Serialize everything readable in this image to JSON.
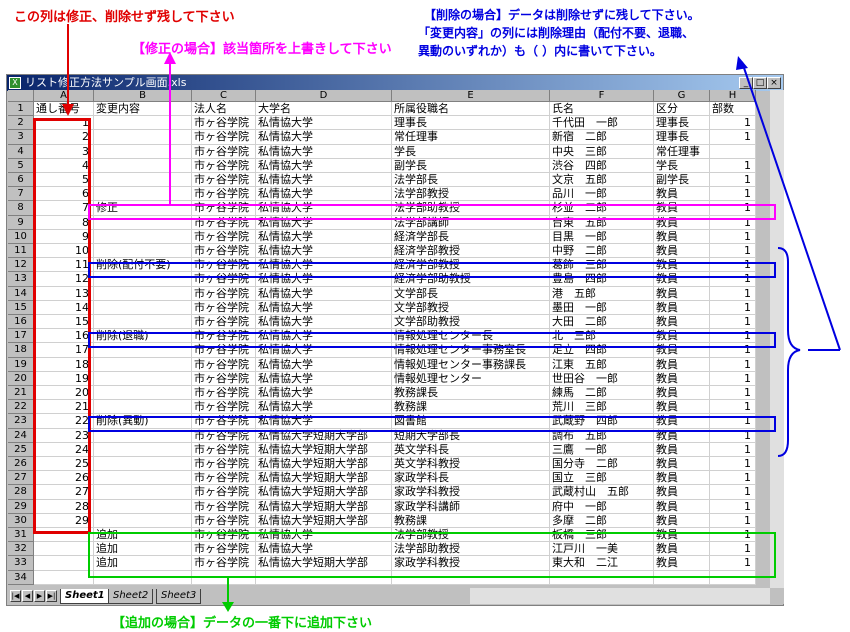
{
  "window": {
    "title": "リスト修正方法サンプル画面.xls",
    "buttons": [
      "_",
      "□",
      "×"
    ]
  },
  "columns": [
    "A",
    "B",
    "C",
    "D",
    "E",
    "F",
    "G",
    "H"
  ],
  "rows": [
    {
      "r": "1",
      "a": "通し番号",
      "b": "変更内容",
      "c": "法人名",
      "d": "大学名",
      "e": "所属役職名",
      "f": "氏名",
      "g": "区分",
      "h": "部数"
    },
    {
      "r": "2",
      "a": "1",
      "b": "",
      "c": "市ヶ谷学院",
      "d": "私情協大学",
      "e": "理事長",
      "f": "千代田　一郎",
      "g": "理事長",
      "h": "1"
    },
    {
      "r": "3",
      "a": "2",
      "b": "",
      "c": "市ヶ谷学院",
      "d": "私情協大学",
      "e": "常任理事",
      "f": "新宿　二郎",
      "g": "理事長",
      "h": "1"
    },
    {
      "r": "4",
      "a": "3",
      "b": "",
      "c": "市ヶ谷学院",
      "d": "私情協大学",
      "e": "学長",
      "f": "中央　三郎",
      "g": "常任理事",
      "h": ""
    },
    {
      "r": "5",
      "a": "4",
      "b": "",
      "c": "市ヶ谷学院",
      "d": "私情協大学",
      "e": "副学長",
      "f": "渋谷　四郎",
      "g": "学長",
      "h": "1"
    },
    {
      "r": "6",
      "a": "5",
      "b": "",
      "c": "市ヶ谷学院",
      "d": "私情協大学",
      "e": "法学部長",
      "f": "文京　五郎",
      "g": "副学長",
      "h": "1"
    },
    {
      "r": "7",
      "a": "6",
      "b": "",
      "c": "市ヶ谷学院",
      "d": "私情協大学",
      "e": "法学部教授",
      "f": "品川　一郎",
      "g": "教員",
      "h": "1"
    },
    {
      "r": "8",
      "a": "7",
      "b": "修正",
      "c": "市ヶ谷学院",
      "d": "私情協大学",
      "e": "法学部助教授",
      "f": "杉並　二郎",
      "g": "教員",
      "h": "1"
    },
    {
      "r": "9",
      "a": "8",
      "b": "",
      "c": "市ヶ谷学院",
      "d": "私情協大学",
      "e": "法学部講師",
      "f": "台東　五郎",
      "g": "教員",
      "h": "1"
    },
    {
      "r": "10",
      "a": "9",
      "b": "",
      "c": "市ヶ谷学院",
      "d": "私情協大学",
      "e": "経済学部長",
      "f": "目黒　一郎",
      "g": "教員",
      "h": "1"
    },
    {
      "r": "11",
      "a": "10",
      "b": "",
      "c": "市ヶ谷学院",
      "d": "私情協大学",
      "e": "経済学部教授",
      "f": "中野　二郎",
      "g": "教員",
      "h": "1"
    },
    {
      "r": "12",
      "a": "11",
      "b": "削除(配付不要)",
      "c": "市ヶ谷学院",
      "d": "私情協大学",
      "e": "経済学部教授",
      "f": "葛飾　三郎",
      "g": "教員",
      "h": "1"
    },
    {
      "r": "13",
      "a": "12",
      "b": "",
      "c": "市ヶ谷学院",
      "d": "私情協大学",
      "e": "経済学部助教授",
      "f": "豊島　四郎",
      "g": "教員",
      "h": "1"
    },
    {
      "r": "14",
      "a": "13",
      "b": "",
      "c": "市ヶ谷学院",
      "d": "私情協大学",
      "e": "文学部長",
      "f": "港　五郎",
      "g": "教員",
      "h": "1"
    },
    {
      "r": "15",
      "a": "14",
      "b": "",
      "c": "市ヶ谷学院",
      "d": "私情協大学",
      "e": "文学部教授",
      "f": "墨田　一郎",
      "g": "教員",
      "h": "1"
    },
    {
      "r": "16",
      "a": "15",
      "b": "",
      "c": "市ヶ谷学院",
      "d": "私情協大学",
      "e": "文学部助教授",
      "f": "大田　二郎",
      "g": "教員",
      "h": "1"
    },
    {
      "r": "17",
      "a": "16",
      "b": "削除(退職)",
      "c": "市ヶ谷学院",
      "d": "私情協大学",
      "e": "情報処理センター長",
      "f": "北　三郎",
      "g": "教員",
      "h": "1"
    },
    {
      "r": "18",
      "a": "17",
      "b": "",
      "c": "市ヶ谷学院",
      "d": "私情協大学",
      "e": "情報処理センター事務室長",
      "f": "足立　四郎",
      "g": "教員",
      "h": "1"
    },
    {
      "r": "19",
      "a": "18",
      "b": "",
      "c": "市ヶ谷学院",
      "d": "私情協大学",
      "e": "情報処理センター事務課長",
      "f": "江東　五郎",
      "g": "教員",
      "h": "1"
    },
    {
      "r": "20",
      "a": "19",
      "b": "",
      "c": "市ヶ谷学院",
      "d": "私情協大学",
      "e": "情報処理センター",
      "f": "世田谷　一郎",
      "g": "教員",
      "h": "1"
    },
    {
      "r": "21",
      "a": "20",
      "b": "",
      "c": "市ヶ谷学院",
      "d": "私情協大学",
      "e": "教務課長",
      "f": "練馬　二郎",
      "g": "教員",
      "h": "1"
    },
    {
      "r": "22",
      "a": "21",
      "b": "",
      "c": "市ヶ谷学院",
      "d": "私情協大学",
      "e": "教務課",
      "f": "荒川　三郎",
      "g": "教員",
      "h": "1"
    },
    {
      "r": "23",
      "a": "22",
      "b": "削除(異動)",
      "c": "市ヶ谷学院",
      "d": "私情協大学",
      "e": "図書館",
      "f": "武蔵野　四郎",
      "g": "教員",
      "h": "1"
    },
    {
      "r": "24",
      "a": "23",
      "b": "",
      "c": "市ヶ谷学院",
      "d": "私情協大学短期大学部",
      "e": "短期大学部長",
      "f": "調布　五郎",
      "g": "教員",
      "h": "1"
    },
    {
      "r": "25",
      "a": "24",
      "b": "",
      "c": "市ヶ谷学院",
      "d": "私情協大学短期大学部",
      "e": "英文学科長",
      "f": "三鷹　一郎",
      "g": "教員",
      "h": "1"
    },
    {
      "r": "26",
      "a": "25",
      "b": "",
      "c": "市ヶ谷学院",
      "d": "私情協大学短期大学部",
      "e": "英文学科教授",
      "f": "国分寺　二郎",
      "g": "教員",
      "h": "1"
    },
    {
      "r": "27",
      "a": "26",
      "b": "",
      "c": "市ヶ谷学院",
      "d": "私情協大学短期大学部",
      "e": "家政学科長",
      "f": "国立　三郎",
      "g": "教員",
      "h": "1"
    },
    {
      "r": "28",
      "a": "27",
      "b": "",
      "c": "市ヶ谷学院",
      "d": "私情協大学短期大学部",
      "e": "家政学科教授",
      "f": "武蔵村山　五郎",
      "g": "教員",
      "h": "1"
    },
    {
      "r": "29",
      "a": "28",
      "b": "",
      "c": "市ヶ谷学院",
      "d": "私情協大学短期大学部",
      "e": "家政学科講師",
      "f": "府中　一郎",
      "g": "教員",
      "h": "1"
    },
    {
      "r": "30",
      "a": "29",
      "b": "",
      "c": "市ヶ谷学院",
      "d": "私情協大学短期大学部",
      "e": "教務課",
      "f": "多摩　二郎",
      "g": "教員",
      "h": "1"
    },
    {
      "r": "31",
      "a": "",
      "b": "追加",
      "c": "市ヶ谷学院",
      "d": "私情協大学",
      "e": "法学部教授",
      "f": "板橋　三郎",
      "g": "教員",
      "h": "1"
    },
    {
      "r": "32",
      "a": "",
      "b": "追加",
      "c": "市ヶ谷学院",
      "d": "私情協大学",
      "e": "法学部助教授",
      "f": "江戸川　一美",
      "g": "教員",
      "h": "1"
    },
    {
      "r": "33",
      "a": "",
      "b": "追加",
      "c": "市ヶ谷学院",
      "d": "私情協大学短期大学部",
      "e": "家政学科教授",
      "f": "東大和　二江",
      "g": "教員",
      "h": "1"
    },
    {
      "r": "34",
      "a": "",
      "b": "",
      "c": "",
      "d": "",
      "e": "",
      "f": "",
      "g": "",
      "h": ""
    }
  ],
  "sheets": [
    "Sheet1",
    "Sheet2",
    "Sheet3"
  ],
  "notes": {
    "red": "この列は修正、削除せず残して下さい",
    "pink": "【修正の場合】該当箇所を上書きして下さい",
    "blue_line1": "【削除の場合】データは削除せずに残して下さい。",
    "blue_line2": "「変更内容」の列には削除理由（配付不要、退職、",
    "blue_line3": "異動のいずれか）も（ ）内に書いて下さい。",
    "green": "【追加の場合】データの一番下に追加下さい"
  },
  "colors": {
    "red": "#e00000",
    "pink": "#ff00ff",
    "blue": "#0000e0",
    "green": "#00cc00"
  }
}
